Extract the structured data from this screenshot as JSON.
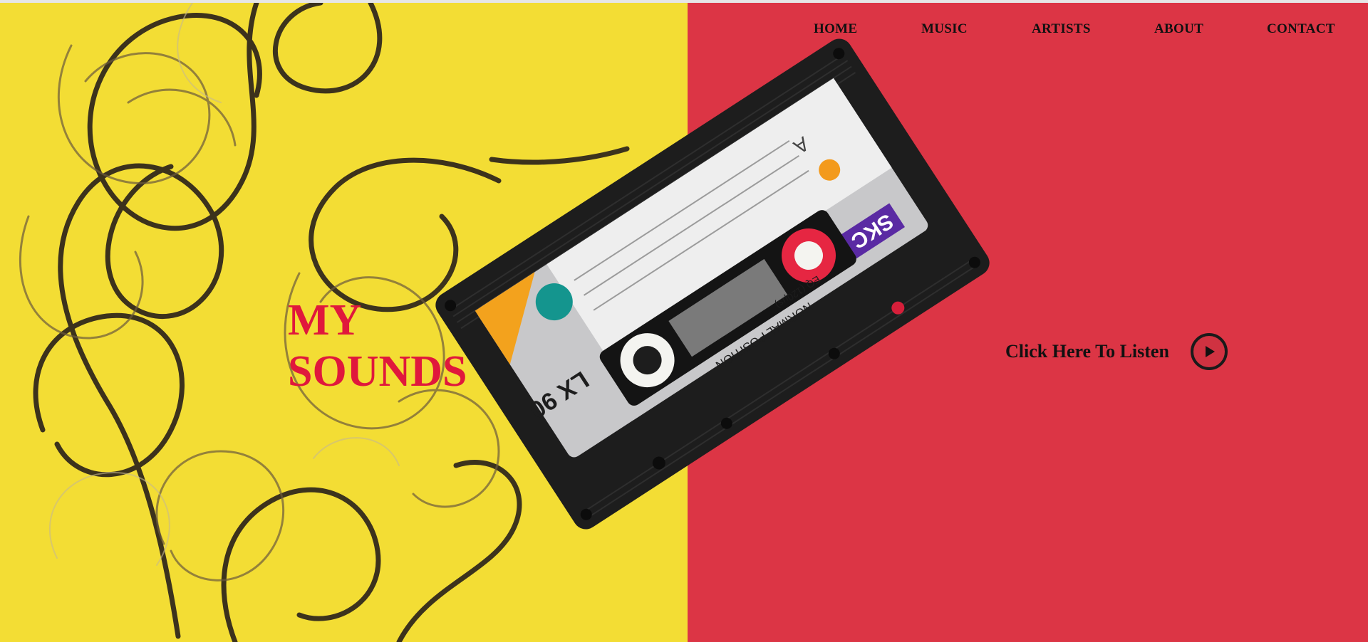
{
  "nav": {
    "home": "HOME",
    "music": "MUSIC",
    "artists": "ARTISTS",
    "about": "ABOUT",
    "contact": "CONTACT"
  },
  "hero": {
    "title_line1": "MY",
    "title_line2": "SOUNDS",
    "listen_label": "Click Here To Listen",
    "play_icon": "play-icon"
  },
  "cassette": {
    "brand": "SKC",
    "model": "LX 90",
    "position_label": "NORMAL POSITION",
    "eq_label": "EQ (120µs)",
    "side": "A"
  },
  "colors": {
    "yellow": "#f3dd34",
    "red": "#dc3545",
    "title": "#e0183c",
    "text": "#111111"
  }
}
